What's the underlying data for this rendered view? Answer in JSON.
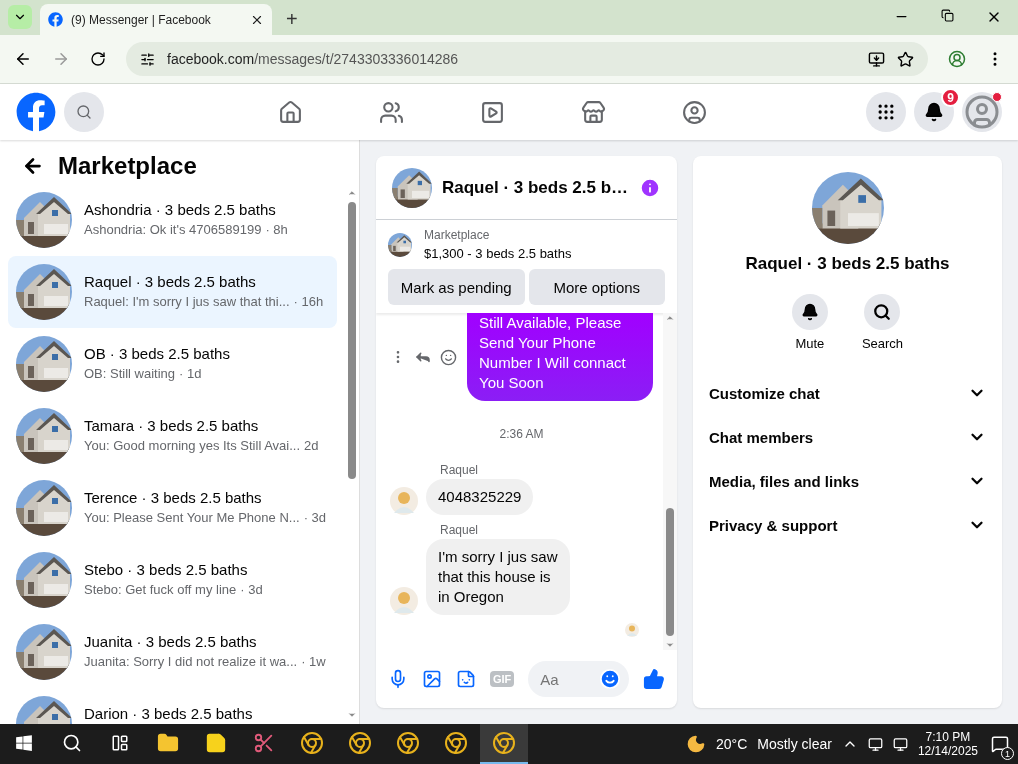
{
  "browser": {
    "tab_title": "(9) Messenger | Facebook",
    "new_tab": "+",
    "url_domain": "facebook.com",
    "url_path": "/messages/t/2743303336014286"
  },
  "header": {
    "notification_count": "9"
  },
  "sidebar": {
    "title": "Marketplace",
    "conversations": [
      {
        "name": "Ashondria · 3 beds 2.5 baths",
        "preview": "Ashondria: Ok it's 4706589199",
        "time": "· 8h",
        "selected": false
      },
      {
        "name": "Raquel · 3 beds 2.5 baths",
        "preview": "Raquel: I'm sorry I jus saw that thi...",
        "time": "· 16h",
        "selected": true
      },
      {
        "name": "OB · 3 beds 2.5 baths",
        "preview": "OB: Still waiting",
        "time": "· 1d",
        "selected": false
      },
      {
        "name": "Tamara · 3 beds 2.5 baths",
        "preview": "You: Good morning yes Its Still Avai...",
        "time": "2d",
        "selected": false
      },
      {
        "name": "Terence · 3 beds 2.5 baths",
        "preview": "You: Please Sent Your Me Phone N...",
        "time": "· 3d",
        "selected": false
      },
      {
        "name": "Stebo · 3 beds 2.5 baths",
        "preview": "Stebo: Get fuck off my line",
        "time": "· 3d",
        "selected": false
      },
      {
        "name": "Juanita · 3 beds 2.5 baths",
        "preview": "Juanita: Sorry I did not realize it wa...",
        "time": "· 1w",
        "selected": false
      },
      {
        "name": "Darion · 3 beds 2.5 baths",
        "selected": false
      }
    ]
  },
  "chat": {
    "title": "Raquel · 3 beds 2.5 b…",
    "listing_label": "Marketplace",
    "listing": "$1,300 - 3 beds 2.5 baths",
    "buttons": [
      "Mark as pending",
      "More options"
    ],
    "messages": [
      {
        "kind": "outgoing",
        "text": "Still Available, Please Send Your Phone Number I Will connact You Soon"
      },
      {
        "kind": "time",
        "text": "2:36 AM"
      },
      {
        "kind": "incoming",
        "sender": "Raquel",
        "text": "4048325229"
      },
      {
        "kind": "incoming",
        "sender": "Raquel",
        "text": "I'm sorry I jus saw that this house is in Oregon"
      }
    ],
    "gif": "GIF",
    "placeholder": "Aa"
  },
  "details": {
    "name": "Raquel · 3 beds 2.5 baths",
    "actions": [
      {
        "kind": "mute",
        "label": "Mute"
      },
      {
        "kind": "search",
        "label": "Search"
      }
    ],
    "sections": [
      {
        "label": "Customize chat",
        "expanded": false
      },
      {
        "label": "Chat members",
        "expanded": false
      },
      {
        "label": "Media, files and links",
        "expanded": false
      },
      {
        "label": "Privacy & support",
        "expanded": false
      }
    ]
  },
  "taskbar": {
    "apps": [
      {
        "kind": "explorer",
        "selected": false
      },
      {
        "kind": "notes",
        "selected": false
      },
      {
        "kind": "snip",
        "selected": false
      },
      {
        "kind": "chrome",
        "selected": false
      },
      {
        "kind": "chrome",
        "selected": false
      },
      {
        "kind": "chrome",
        "selected": false
      },
      {
        "kind": "chrome",
        "selected": false
      },
      {
        "kind": "chrome",
        "selected": true
      }
    ],
    "temperature": "20°C",
    "weather": "Mostly clear",
    "time": "7:10 PM",
    "date": "12/14/2025",
    "notification_count": "1"
  }
}
